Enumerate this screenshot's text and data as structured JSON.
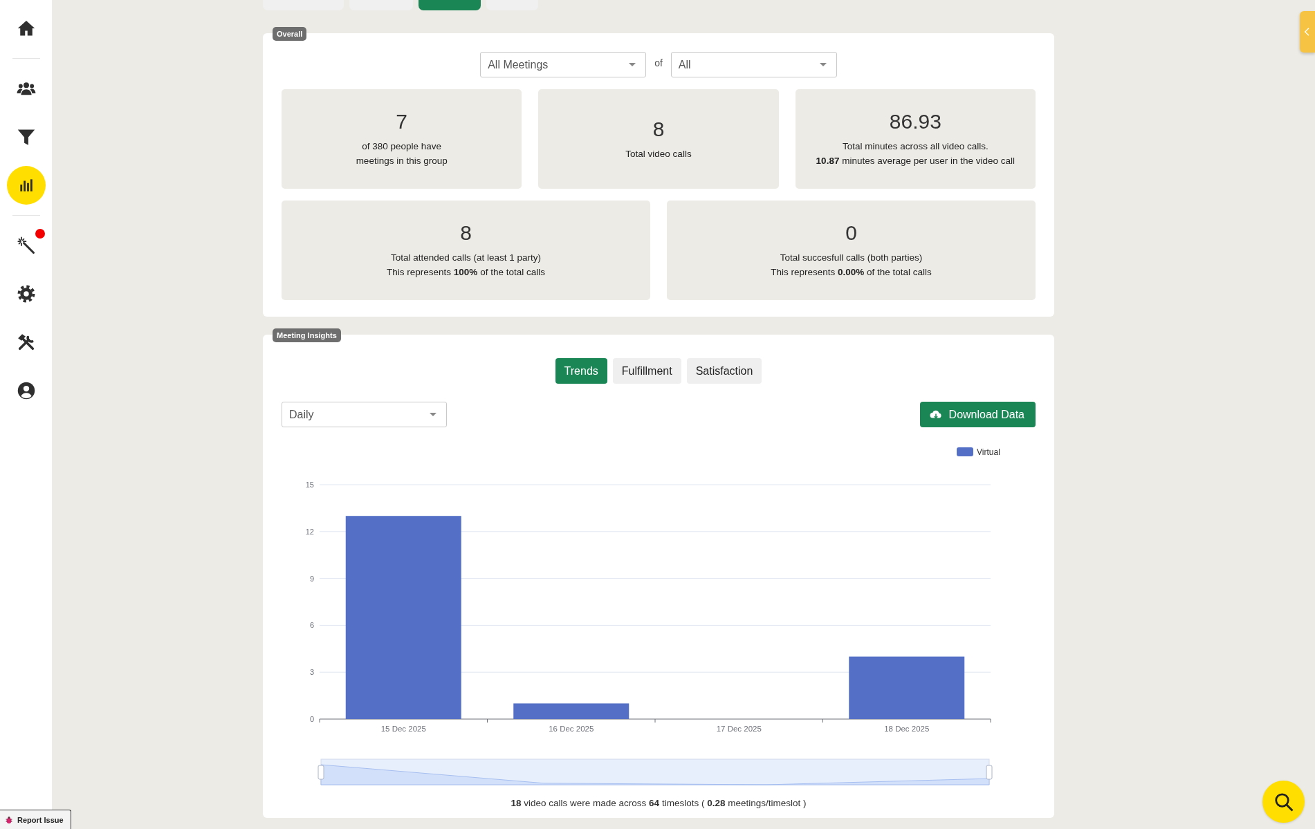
{
  "sidebar": {
    "items": [
      {
        "selected": false,
        "notification": false
      },
      {
        "selected": false,
        "notification": false
      },
      {
        "selected": false,
        "notification": false
      },
      {
        "selected": true,
        "notification": false
      },
      {
        "selected": false,
        "notification": true
      },
      {
        "selected": false,
        "notification": false
      },
      {
        "selected": false,
        "notification": false
      },
      {
        "selected": false,
        "notification": false
      }
    ]
  },
  "top_tabs": [
    {
      "selected": false
    },
    {
      "selected": false
    },
    {
      "selected": true
    },
    {
      "selected": false
    }
  ],
  "overall": {
    "badge": "Overall",
    "filters": [
      {
        "value": "All Meetings"
      },
      {
        "value": "All"
      }
    ],
    "connector": "of",
    "stats": [
      {
        "value": "7",
        "lines": [
          "of 380 people have",
          "meetings in this group"
        ]
      },
      {
        "value": "8",
        "lines": [
          "Total video calls"
        ]
      },
      {
        "value": "86.93",
        "lines": [
          "Total minutes across all video calls.",
          "**10.87** minutes average per user in the video call"
        ]
      },
      {
        "value": "8",
        "lines": [
          "Total attended calls (at least 1 party)",
          "This represents **100%** of the total calls"
        ]
      },
      {
        "value": "0",
        "lines": [
          "Total succesfull calls (both parties)",
          "This represents **0.00%** of the total calls"
        ]
      }
    ]
  },
  "insights": {
    "badge": "Meeting Insights",
    "tabs": [
      {
        "label": "Trends",
        "selected": true
      },
      {
        "label": "Fulfillment",
        "selected": false
      },
      {
        "label": "Satisfaction",
        "selected": false
      }
    ],
    "period": {
      "value": "Daily"
    },
    "download_button": "Download Data",
    "chart_data": {
      "type": "bar",
      "categories": [
        "15 Dec 2025",
        "16 Dec 2025",
        "17 Dec 2025",
        "18 Dec 2025"
      ],
      "series": [
        {
          "name": "Virtual",
          "color": "#5470c6",
          "values": [
            13,
            1,
            0,
            4
          ]
        }
      ],
      "ylim": [
        0,
        15
      ],
      "yticks": [
        0,
        3,
        6,
        9,
        12,
        15
      ],
      "grid": true
    },
    "summary": "**18** video calls were made across **64** timeslots ( **0.28** meetings/timeslot )"
  },
  "report_issue": "Report Issue"
}
